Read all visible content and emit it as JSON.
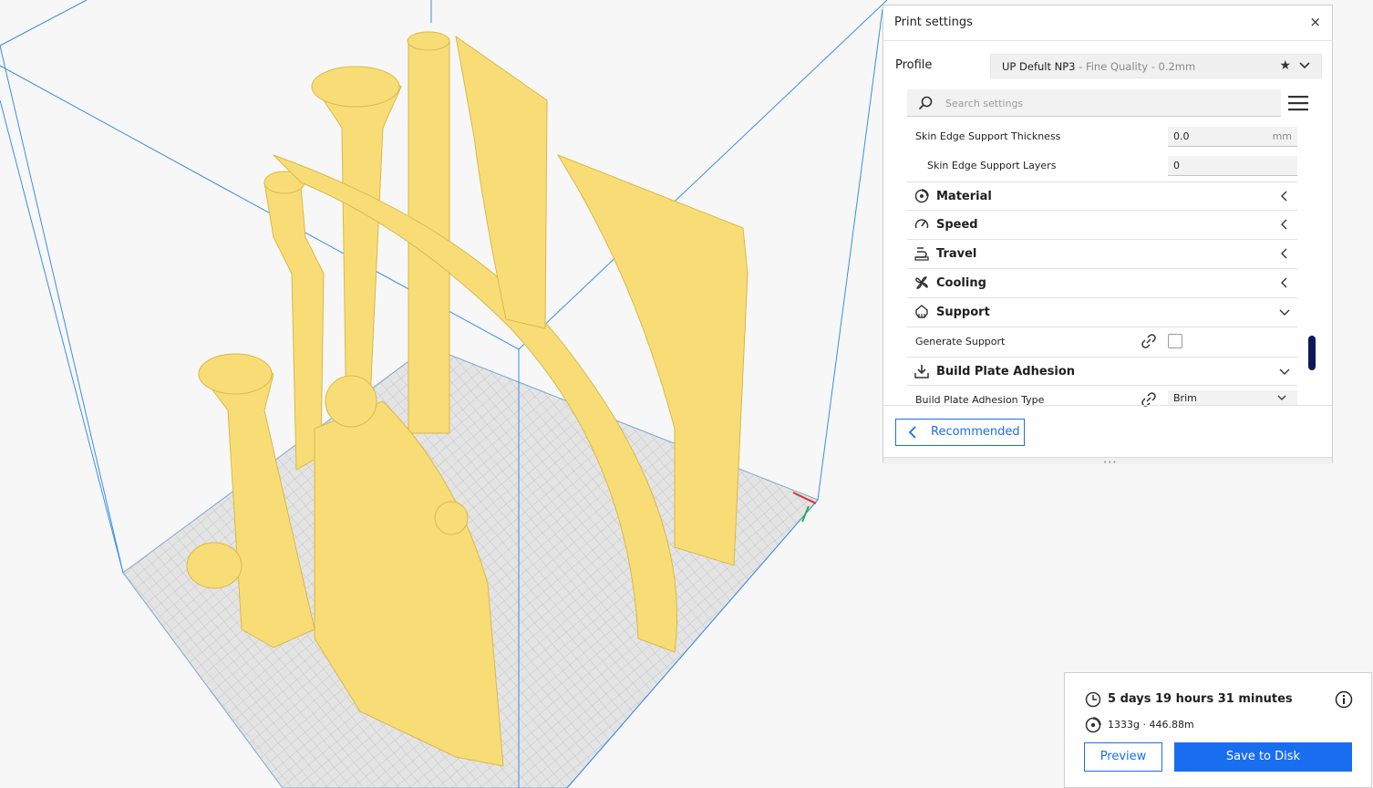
{
  "panel": {
    "title": "Print settings",
    "close": "×"
  },
  "profile": {
    "label": "Profile",
    "name": "UP Defult NP3",
    "quality": " - Fine Quality - 0.2mm"
  },
  "search": {
    "placeholder": "Search settings"
  },
  "settings": {
    "skin_edge_thickness": {
      "label": "Skin Edge Support Thickness",
      "value": "0.0",
      "unit": "mm"
    },
    "skin_edge_layers": {
      "label": "Skin Edge Support Layers",
      "value": "0"
    },
    "generate_support": {
      "label": "Generate Support",
      "checked": false
    },
    "adhesion_type": {
      "label": "Build Plate Adhesion Type",
      "value": "Brim"
    }
  },
  "categories": {
    "material": "Material",
    "speed": "Speed",
    "travel": "Travel",
    "cooling": "Cooling",
    "support": "Support",
    "adhesion": "Build Plate Adhesion"
  },
  "recommended_label": "Recommended",
  "estimate": {
    "time": "5 days 19 hours 31 minutes",
    "material": "1333g · 446.88m"
  },
  "buttons": {
    "preview": "Preview",
    "save": "Save to Disk"
  },
  "colors": {
    "accent": "#196ef0",
    "model": "#f8dd76",
    "build_volume": "#3b8ee6",
    "scroll_thumb": "#0a1b5c"
  }
}
